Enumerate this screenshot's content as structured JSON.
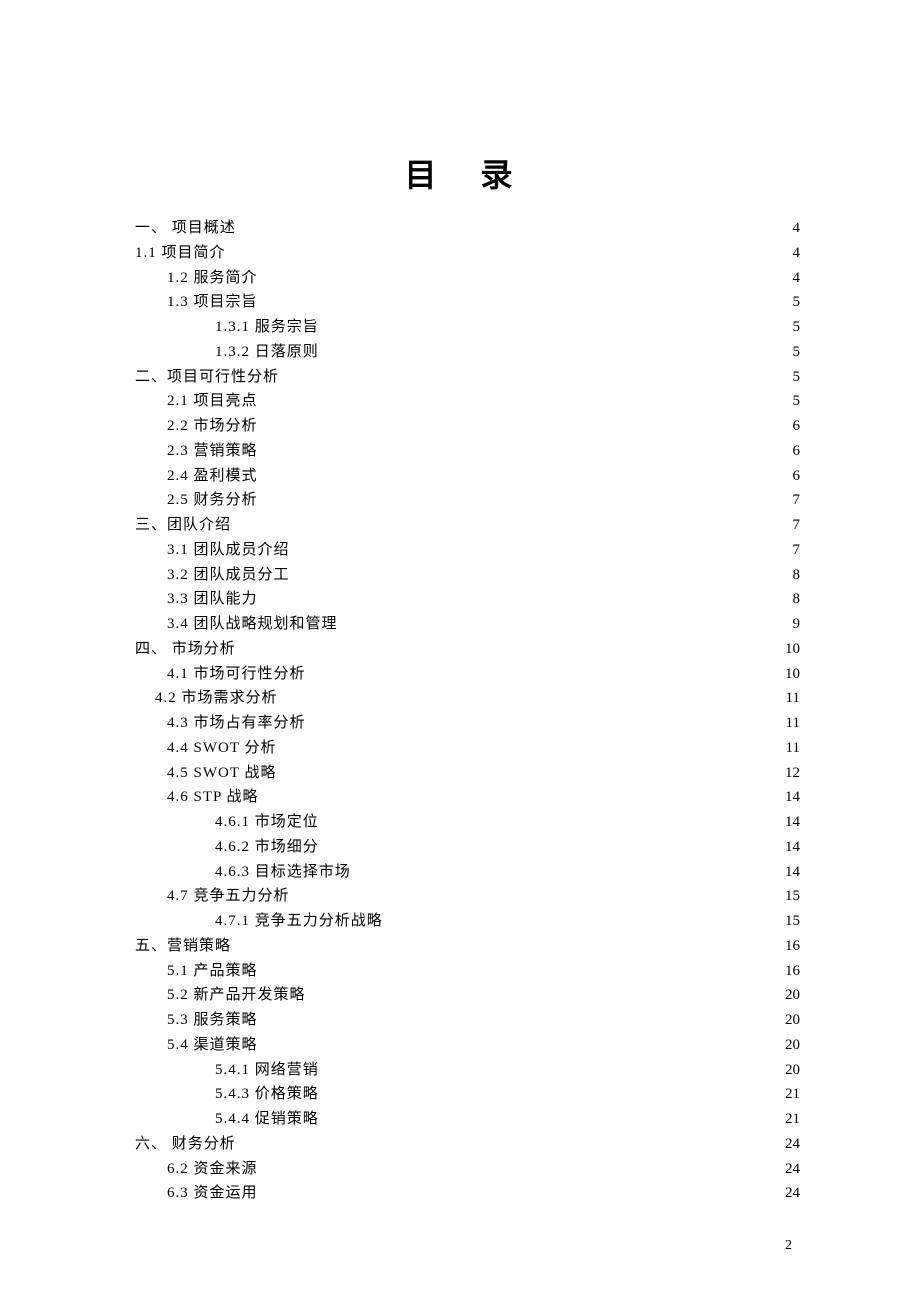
{
  "title": "目 录",
  "pageNumber": "2",
  "toc": [
    {
      "indent": "ind-0",
      "label": "一、 项目概述",
      "page": "4"
    },
    {
      "indent": "ind-0",
      "label": "1.1 项目简介",
      "page": "4"
    },
    {
      "indent": "ind-1",
      "label": "1.2 服务简介",
      "page": "4"
    },
    {
      "indent": "ind-1",
      "label": "1.3 项目宗旨",
      "page": "5"
    },
    {
      "indent": "ind-2",
      "label": "1.3.1 服务宗旨",
      "page": "5"
    },
    {
      "indent": "ind-2",
      "label": "1.3.2 日落原则",
      "page": "5"
    },
    {
      "indent": "ind-0",
      "label": "二、项目可行性分析",
      "page": "5"
    },
    {
      "indent": "ind-1",
      "label": "2.1 项目亮点",
      "page": "5"
    },
    {
      "indent": "ind-1",
      "label": "2.2 市场分析",
      "page": "6"
    },
    {
      "indent": "ind-1",
      "label": "2.3 营销策略",
      "page": "6"
    },
    {
      "indent": "ind-1",
      "label": "2.4 盈利模式",
      "page": "6"
    },
    {
      "indent": "ind-1",
      "label": "2.5 财务分析",
      "page": "7"
    },
    {
      "indent": "ind-0",
      "label": "三、团队介绍",
      "page": "7"
    },
    {
      "indent": "ind-1",
      "label": "3.1 团队成员介绍",
      "page": "7"
    },
    {
      "indent": "ind-1",
      "label": "3.2 团队成员分工",
      "page": "8"
    },
    {
      "indent": "ind-1",
      "label": "3.3 团队能力",
      "page": "8"
    },
    {
      "indent": "ind-1",
      "label": "3.4 团队战略规划和管理",
      "page": "9"
    },
    {
      "indent": "ind-0",
      "label": "四、 市场分析",
      "page": "10"
    },
    {
      "indent": "ind-1",
      "label": "4.1 市场可行性分析",
      "page": "10"
    },
    {
      "indent": "ind-0b",
      "label": "4.2 市场需求分析",
      "page": "11"
    },
    {
      "indent": "ind-1",
      "label": "4.3 市场占有率分析",
      "page": "11"
    },
    {
      "indent": "ind-1",
      "label": "4.4 SWOT 分析",
      "page": "11"
    },
    {
      "indent": "ind-1",
      "label": "4.5 SWOT 战略",
      "page": "12"
    },
    {
      "indent": "ind-1",
      "label": "4.6 STP 战略",
      "page": "14"
    },
    {
      "indent": "ind-2",
      "label": "4.6.1 市场定位",
      "page": "14"
    },
    {
      "indent": "ind-2",
      "label": "4.6.2 市场细分",
      "page": "14"
    },
    {
      "indent": "ind-2",
      "label": "4.6.3 目标选择市场",
      "page": "14"
    },
    {
      "indent": "ind-1",
      "label": "4.7 竞争五力分析",
      "page": "15"
    },
    {
      "indent": "ind-2",
      "label": "4.7.1 竞争五力分析战略",
      "page": "15"
    },
    {
      "indent": "ind-0",
      "label": "五、营销策略",
      "page": "16"
    },
    {
      "indent": "ind-1",
      "label": "5.1 产品策略",
      "page": "16"
    },
    {
      "indent": "ind-1",
      "label": "5.2 新产品开发策略",
      "page": "20"
    },
    {
      "indent": "ind-1",
      "label": "5.3 服务策略",
      "page": "20"
    },
    {
      "indent": "ind-1",
      "label": "5.4 渠道策略",
      "page": "20"
    },
    {
      "indent": "ind-2",
      "label": "5.4.1 网络营销",
      "page": "20"
    },
    {
      "indent": "ind-2",
      "label": "5.4.3 价格策略",
      "page": "21"
    },
    {
      "indent": "ind-2",
      "label": "5.4.4 促销策略",
      "page": "21"
    },
    {
      "indent": "ind-0",
      "label": "六、 财务分析",
      "page": "24"
    },
    {
      "indent": "ind-1",
      "label": "6.2 资金来源",
      "page": "24"
    },
    {
      "indent": "ind-1",
      "label": "6.3 资金运用",
      "page": "24"
    }
  ]
}
